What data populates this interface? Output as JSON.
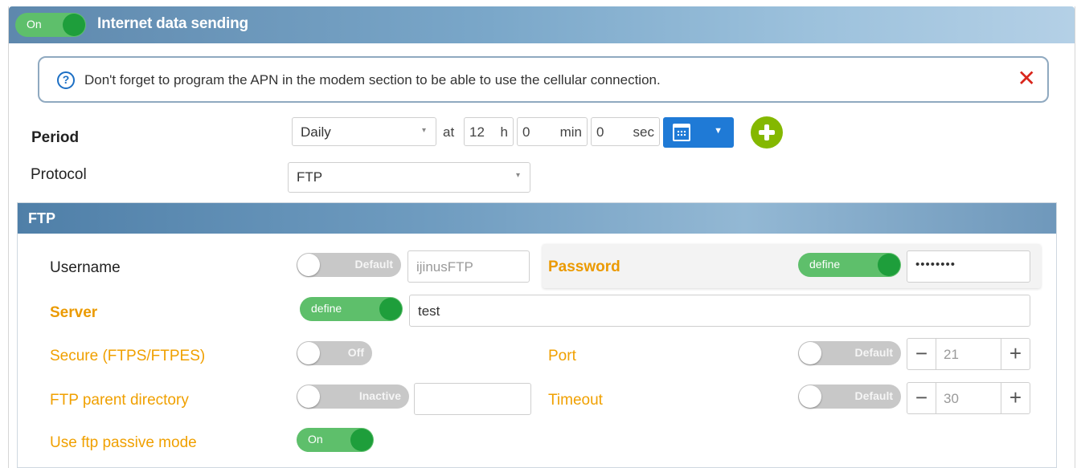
{
  "header": {
    "toggle_label": "On",
    "title": "Internet data sending"
  },
  "info": {
    "icon": "help-circle-icon",
    "message": "Don't forget to program the APN in the modem section to be able to use the cellular connection.",
    "close_icon": "close-icon"
  },
  "period": {
    "label": "Period",
    "value": "Daily",
    "at_label": "at",
    "hour": "12",
    "hour_unit": "h",
    "minute": "0",
    "minute_unit": "min",
    "second": "0",
    "second_unit": "sec",
    "calendar_icon": "calendar-icon",
    "add_icon": "plus-circle-icon"
  },
  "protocol": {
    "label": "Protocol",
    "value": "FTP"
  },
  "ftp": {
    "title": "FTP",
    "username": {
      "label": "Username",
      "toggle": "Default",
      "value": "ijinusFTP"
    },
    "password": {
      "label": "Password",
      "toggle": "define",
      "value": "••••••••"
    },
    "server": {
      "label": "Server",
      "toggle": "define",
      "value": "test"
    },
    "secure": {
      "label": "Secure (FTPS/FTPES)",
      "toggle": "Off"
    },
    "port": {
      "label": "Port",
      "toggle": "Default",
      "value": "21"
    },
    "parent_dir": {
      "label": "FTP parent directory",
      "toggle": "Inactive",
      "value": ""
    },
    "timeout": {
      "label": "Timeout",
      "toggle": "Default",
      "value": "30"
    },
    "passive": {
      "label": "Use ftp passive mode",
      "toggle": "On"
    }
  },
  "colors": {
    "header_start": "#5e88ad",
    "toggle_on": "#5ebf6b",
    "knob_on": "#1e9e3b",
    "toggle_off": "#c8c8c8",
    "required_label": "#eb9a00",
    "calendar_button": "#1f7ad6",
    "add_button": "#84b800",
    "close_x": "#d9261c"
  }
}
